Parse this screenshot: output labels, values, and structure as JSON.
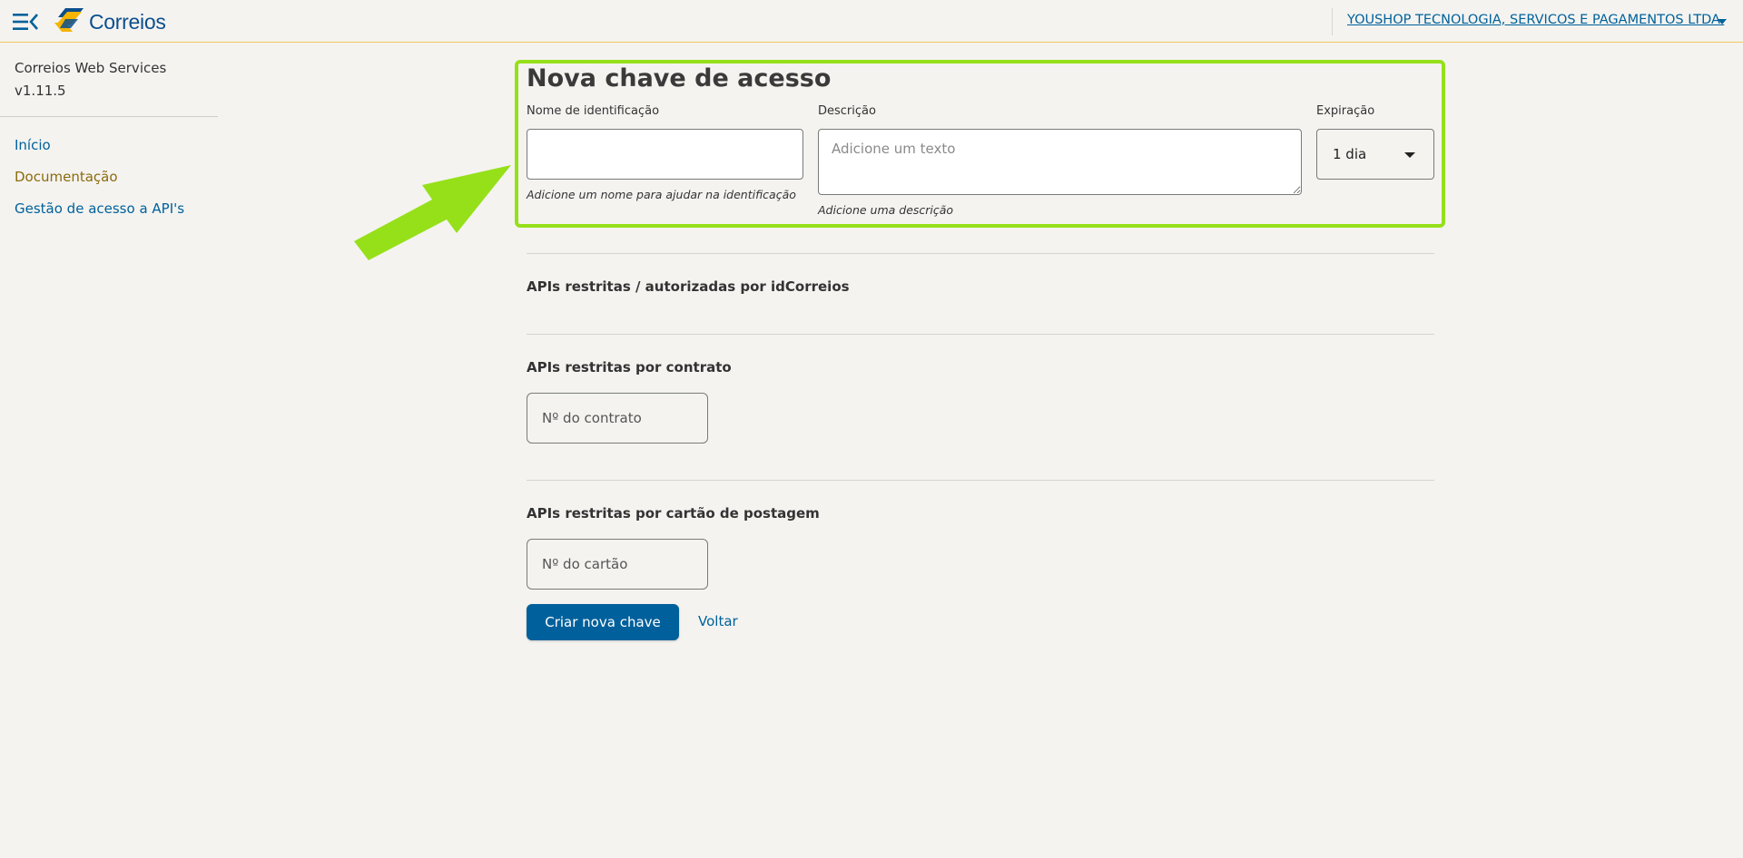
{
  "header": {
    "logo_text": "Correios",
    "company_name": "YOUSHOP TECNOLOGIA, SERVICOS E PAGAMENTOS LTDA.",
    "menu_icon": "menu-collapse-icon",
    "dropdown_icon": "caret-down-icon"
  },
  "sidebar": {
    "app_name": "Correios Web Services",
    "version": "v1.11.5",
    "items": [
      {
        "label": "Início"
      },
      {
        "label": "Documentação"
      },
      {
        "label": "Gestão de acesso a API's"
      }
    ]
  },
  "form": {
    "title": "Nova chave de acesso",
    "name_label": "Nome de identificação",
    "name_value": "",
    "name_hint": "Adicione um nome para ajudar na identificação",
    "description_label": "Descrição",
    "description_placeholder": "Adicione um texto",
    "description_hint": "Adicione uma descrição",
    "expiration_label": "Expiração",
    "expiration_value": "1 dia"
  },
  "sections": {
    "idcorreios_title": "APIs restritas / autorizadas por idCorreios",
    "contract_title": "APIs restritas por contrato",
    "contract_placeholder": "Nº do contrato",
    "card_title": "APIs restritas por cartão de postagem",
    "card_placeholder": "Nº do cartão"
  },
  "actions": {
    "create_label": "Criar nova chave",
    "back_label": "Voltar"
  },
  "colors": {
    "brand_blue": "#00609c",
    "brand_yellow": "#f5b400",
    "highlight_green": "#96e01a",
    "link_gold": "#8c6b0d"
  }
}
